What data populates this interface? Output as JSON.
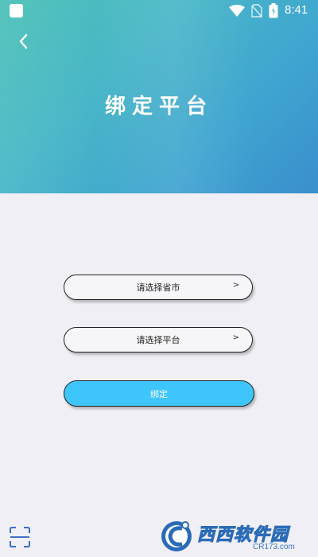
{
  "status_bar": {
    "time": "8:41"
  },
  "header": {
    "title": "绑定平台",
    "gradient_colors": [
      "#4cc1b7",
      "#3a8fcc"
    ]
  },
  "form": {
    "province_select_label": "请选择省市",
    "province_select_chevron": ">",
    "platform_select_label": "请选择平台",
    "platform_select_chevron": ">",
    "bind_button_label": "绑定",
    "bind_button_color": "#3ec5fb"
  },
  "watermark": {
    "main": "西西软件园",
    "sub": "CR173.com"
  },
  "icons": {
    "back": "back-arrow-icon",
    "scan": "scan-icon",
    "wifi": "wifi-icon",
    "no_sim": "no-sim-icon",
    "battery": "battery-icon"
  }
}
